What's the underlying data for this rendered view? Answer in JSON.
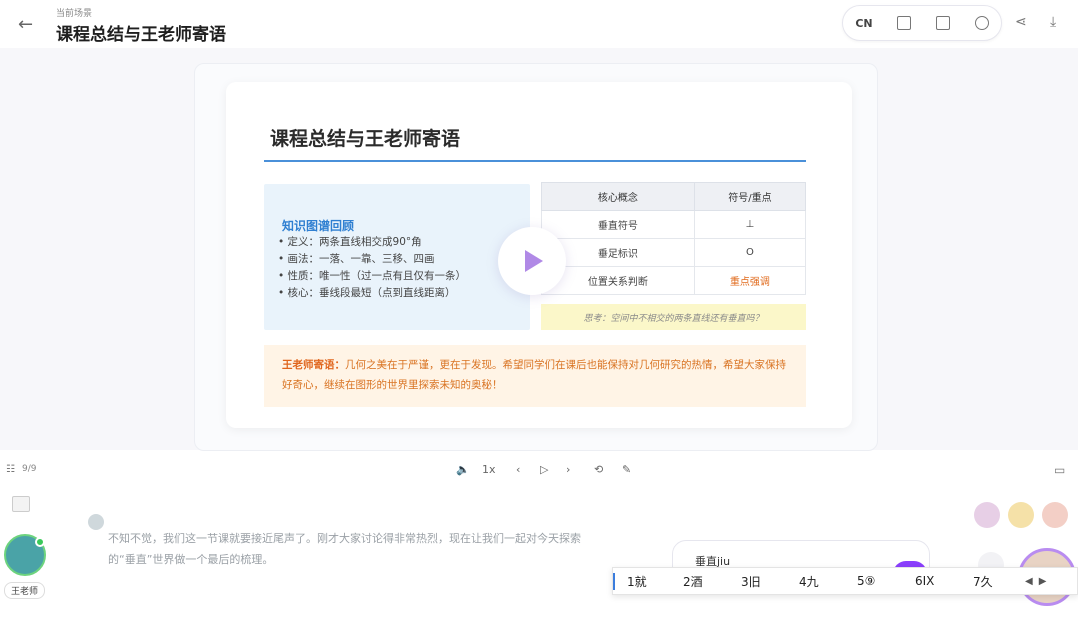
{
  "header": {
    "crumb": "当前场景",
    "title": "课程总结与王老师寄语",
    "toolbar": {
      "lang": "CN"
    }
  },
  "slide": {
    "title": "课程总结与王老师寄语",
    "knowledge": {
      "title": "知识图谱回顾",
      "items": [
        "• 定义：两条直线相交成90°角",
        "• 画法：一落、一靠、三移、四画",
        "• 性质：唯一性（过一点有且仅有一条）",
        "• 核心：垂线段最短（点到直线距离）"
      ]
    },
    "table": {
      "headers": [
        "核心概念",
        "符号/重点"
      ],
      "rows": [
        [
          "垂直符号",
          "⊥"
        ],
        [
          "垂足标识",
          "O"
        ],
        [
          "位置关系判断",
          "重点强调"
        ]
      ]
    },
    "note": "思考：空间中不相交的两条直线还有垂直吗？",
    "message": {
      "lead": "王老师寄语：",
      "text": "几何之美在于严谨，更在于发现。希望同学们在课后也能保持对几何研究的热情，希望大家保持好奇心，继续在图形的世界里探索未知的奥秘！"
    }
  },
  "controls": {
    "page": "9/9",
    "speed": "1x"
  },
  "chat": {
    "speech": "不知不觉，我们这一节课就要接近尾声了。刚才大家讨论得非常热烈，现在让我们一起对今天探索的“垂直”世界做一个最后的梳理。",
    "teacher_name": "王老师",
    "input_value": "垂直jiu",
    "ime": [
      "1就",
      "2酒",
      "3旧",
      "4九",
      "5⑨",
      "6IX",
      "7久"
    ]
  }
}
